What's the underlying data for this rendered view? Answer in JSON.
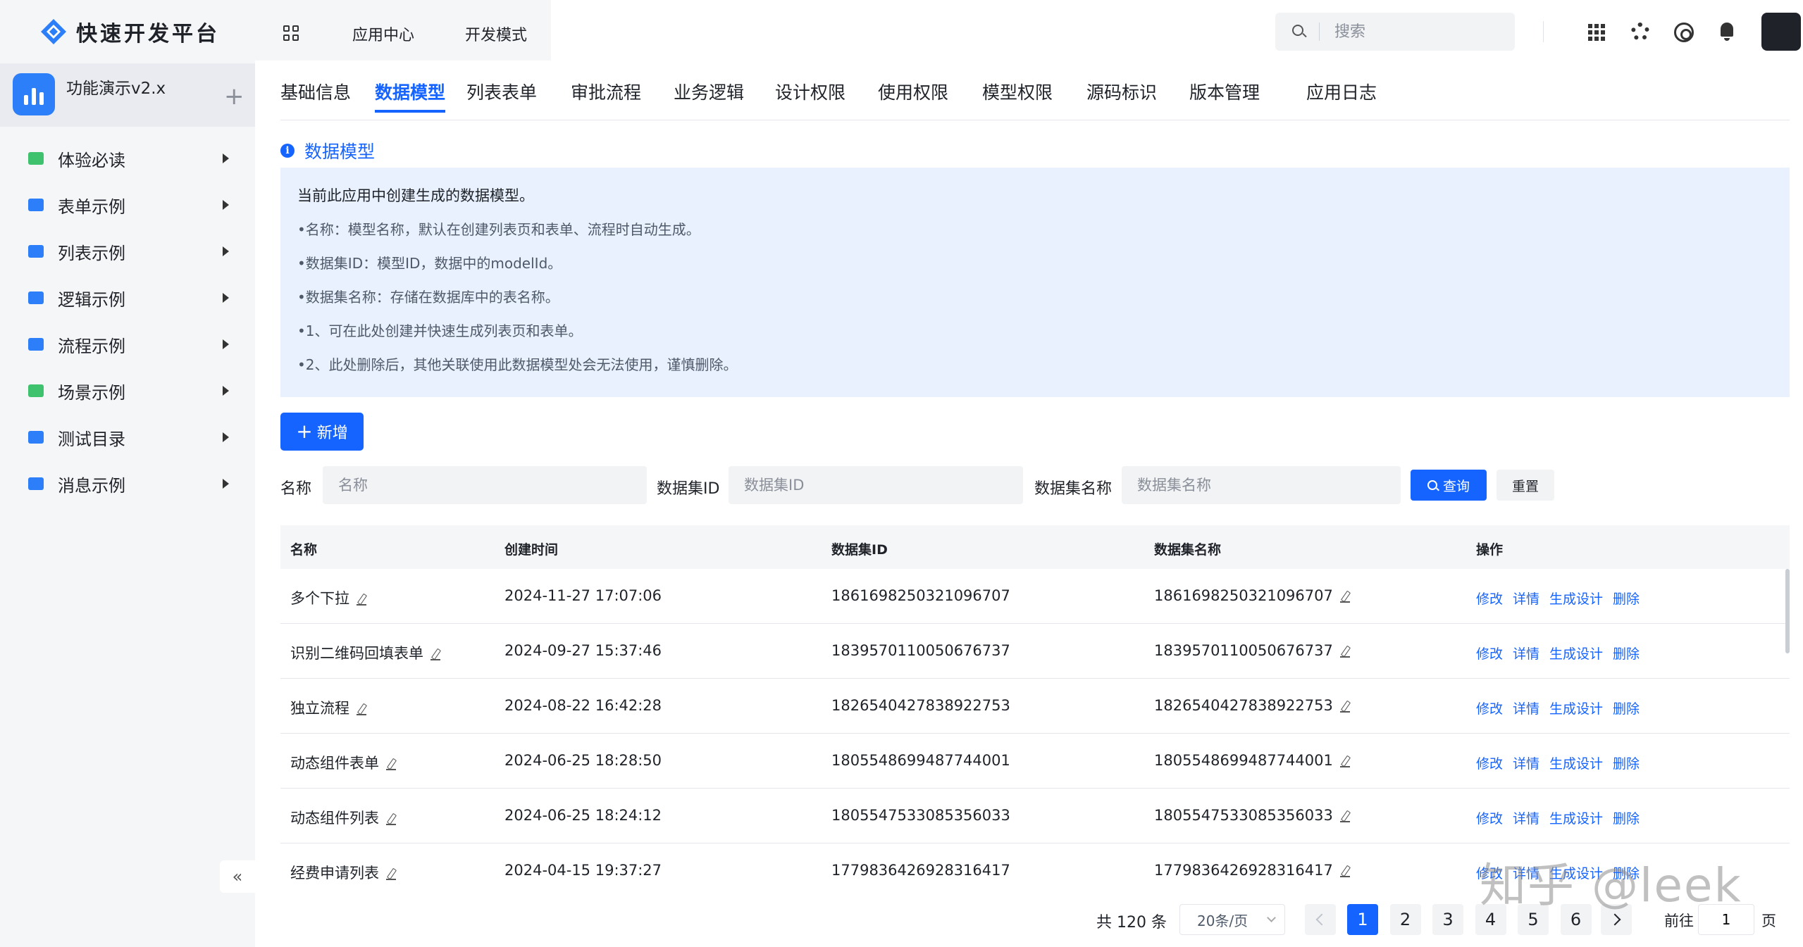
{
  "logo": {
    "text": "快速开发平台"
  },
  "app": {
    "name": "功能演示v2.x"
  },
  "sidebar": {
    "items": [
      {
        "label": "体验必读",
        "color": "#3ec26d"
      },
      {
        "label": "表单示例",
        "color": "#2d7ff9"
      },
      {
        "label": "列表示例",
        "color": "#2d7ff9"
      },
      {
        "label": "逻辑示例",
        "color": "#2d7ff9"
      },
      {
        "label": "流程示例",
        "color": "#2d7ff9"
      },
      {
        "label": "场景示例",
        "color": "#3ec26d"
      },
      {
        "label": "测试目录",
        "color": "#2d7ff9"
      },
      {
        "label": "消息示例",
        "color": "#2d7ff9"
      }
    ],
    "collapse_label": "«"
  },
  "topnav": {
    "app_center": "应用中心",
    "dev_mode": "开发模式"
  },
  "search": {
    "placeholder": "搜索"
  },
  "tabs": [
    "基础信息",
    "数据模型",
    "列表表单",
    "审批流程",
    "业务逻辑",
    "设计权限",
    "使用权限",
    "模型权限",
    "源码标识",
    "版本管理",
    "应用日志"
  ],
  "section": {
    "title": "数据模型",
    "intro": "当前此应用中创建生成的数据模型。",
    "items": [
      "•名称：模型名称，默认在创建列表页和表单、流程时自动生成。",
      "•数据集ID：模型ID，数据中的modelId。",
      "•数据集名称：存储在数据库中的表名称。",
      "•1、可在此处创建并快速生成列表页和表单。",
      "•2、此处删除后，其他关联使用此数据模型处会无法使用，谨慎删除。"
    ]
  },
  "add_button": {
    "label": "新增"
  },
  "filters": {
    "name_label": "名称",
    "name_placeholder": "名称",
    "dsid_label": "数据集ID",
    "dsid_placeholder": "数据集ID",
    "dsname_label": "数据集名称",
    "dsname_placeholder": "数据集名称",
    "query_label": "查询",
    "reset_label": "重置"
  },
  "table": {
    "headers": [
      "名称",
      "创建时间",
      "数据集ID",
      "数据集名称",
      "操作"
    ],
    "actions": [
      "修改",
      "详情",
      "生成设计",
      "删除"
    ],
    "rows": [
      {
        "name": "多个下拉",
        "created": "2024-11-27 17:07:06",
        "dsid": "1861698250321096707",
        "dsname": "1861698250321096707"
      },
      {
        "name": "识别二维码回填表单",
        "created": "2024-09-27 15:37:46",
        "dsid": "1839570110050676737",
        "dsname": "1839570110050676737"
      },
      {
        "name": "独立流程",
        "created": "2024-08-22 16:42:28",
        "dsid": "1826540427838922753",
        "dsname": "1826540427838922753"
      },
      {
        "name": "动态组件表单",
        "created": "2024-06-25 18:28:50",
        "dsid": "1805548699487744001",
        "dsname": "1805548699487744001"
      },
      {
        "name": "动态组件列表",
        "created": "2024-06-25 18:24:12",
        "dsid": "1805547533085356033",
        "dsname": "1805547533085356033"
      },
      {
        "name": "经费申请列表",
        "created": "2024-04-15 19:37:27",
        "dsid": "1779836426928316417",
        "dsname": "1779836426928316417"
      }
    ]
  },
  "pagination": {
    "total": "共 120 条",
    "page_size": "20条/页",
    "pages": [
      "1",
      "2",
      "3",
      "4",
      "5",
      "6"
    ],
    "current": "1",
    "goto_label": "前往",
    "goto_value": "1",
    "page_suffix": "页"
  },
  "brand_watermark": "知乎 @leek",
  "colors": {
    "accent": "#1664ff",
    "notice_bg": "#e8f1fd",
    "sidebar_bg": "#f5f6f8"
  }
}
